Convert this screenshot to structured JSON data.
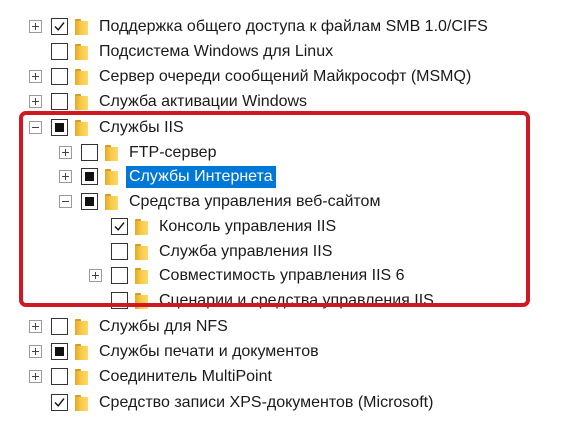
{
  "tree": {
    "items": [
      {
        "label": "Поддержка общего доступа к файлам SMB 1.0/CIFS",
        "expander": "plus",
        "state": "checked"
      },
      {
        "label": "Подсистема Windows для Linux",
        "expander": "none",
        "state": "unchecked"
      },
      {
        "label": "Сервер очереди сообщений Майкрософт (MSMQ)",
        "expander": "plus",
        "state": "unchecked"
      },
      {
        "label": "Служба активации Windows",
        "expander": "plus",
        "state": "unchecked"
      },
      {
        "label": "Службы IIS",
        "expander": "minus",
        "state": "partial"
      },
      {
        "label": "FTP-сервер",
        "expander": "plus",
        "state": "unchecked"
      },
      {
        "label": "Службы Интернета",
        "expander": "plus",
        "state": "partial",
        "selected": true
      },
      {
        "label": "Средства управления веб-сайтом",
        "expander": "minus",
        "state": "partial"
      },
      {
        "label": "Консоль управления IIS",
        "expander": "none",
        "state": "checked"
      },
      {
        "label": "Служба управления IIS",
        "expander": "none",
        "state": "unchecked"
      },
      {
        "label": "Совместимость управления IIS 6",
        "expander": "plus",
        "state": "unchecked"
      },
      {
        "label": "Сценарии и средства управления IIS",
        "expander": "none",
        "state": "unchecked"
      },
      {
        "label": "Службы для NFS",
        "expander": "plus",
        "state": "unchecked"
      },
      {
        "label": "Службы печати и документов",
        "expander": "plus",
        "state": "partial"
      },
      {
        "label": "Соединитель MultiPoint",
        "expander": "plus",
        "state": "unchecked"
      },
      {
        "label": "Средство записи XPS-документов (Microsoft)",
        "expander": "none",
        "state": "checked"
      }
    ]
  },
  "colors": {
    "highlight_frame": "#d01822",
    "selection": "#0078d7",
    "folder": "#f6c94a"
  }
}
